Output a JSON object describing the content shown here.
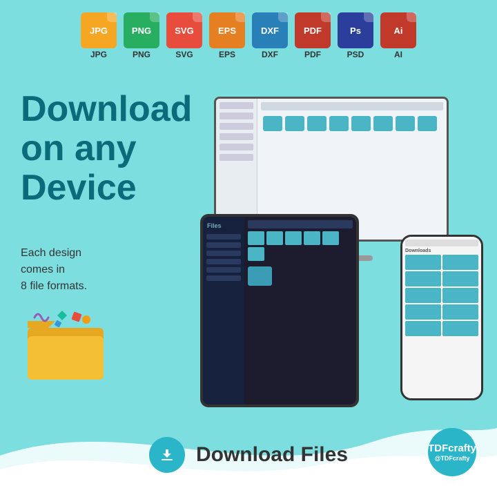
{
  "background_color": "#7cdede",
  "file_formats": [
    {
      "id": "jpg",
      "label": "JPG",
      "top_label": "JPG",
      "color": "#f5a623"
    },
    {
      "id": "png",
      "label": "PNG",
      "top_label": "PNG",
      "color": "#27ae60"
    },
    {
      "id": "svg",
      "label": "SVG",
      "top_label": "SVG",
      "color": "#e74c3c"
    },
    {
      "id": "eps",
      "label": "EPS",
      "top_label": "EPS",
      "color": "#e67e22"
    },
    {
      "id": "dxf",
      "label": "DXF",
      "top_label": "DXF",
      "color": "#2980b9"
    },
    {
      "id": "pdf",
      "label": "PDF",
      "top_label": "PDF",
      "color": "#c0392b"
    },
    {
      "id": "psd",
      "label": "Ps",
      "top_label": "PSD",
      "color": "#2c3e9b"
    },
    {
      "id": "ai",
      "label": "Ai",
      "top_label": "AI",
      "color": "#c0392b"
    }
  ],
  "heading": {
    "line1": "Download",
    "line2": "on any",
    "line3": "Device"
  },
  "subtext": "Each design\ncomes in\n8 file formats.",
  "download_button_label": "Download Files",
  "brand": {
    "name": "TDFcrafty",
    "handle": "@TDFcrafty"
  }
}
